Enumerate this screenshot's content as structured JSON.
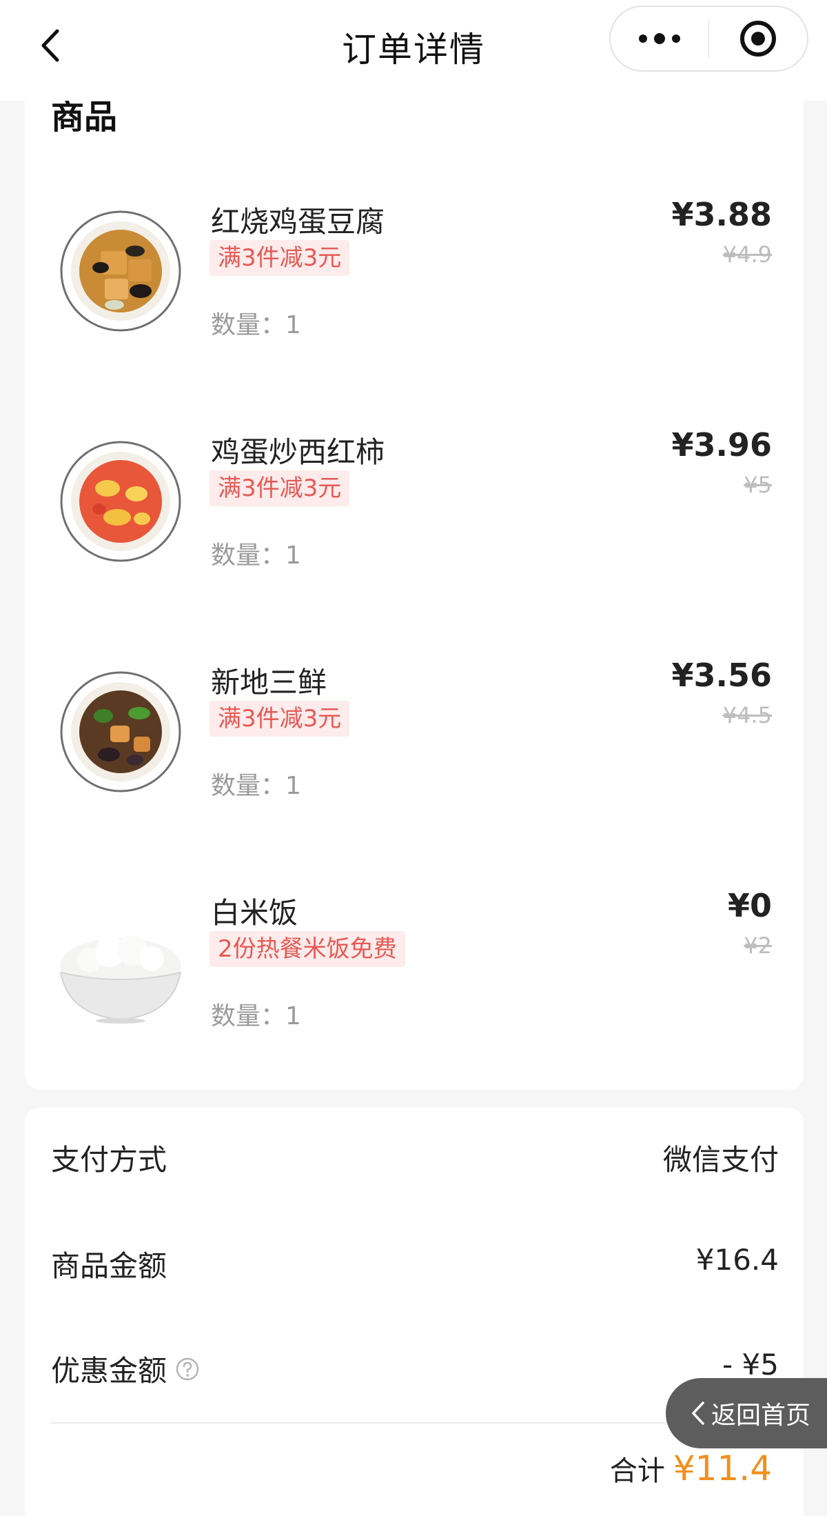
{
  "header": {
    "title": "订单详情",
    "back_icon": "chevron-left-icon",
    "menu_icon": "more-dots-icon",
    "close_icon": "target-circle-icon"
  },
  "goods": {
    "section_title": "商品",
    "items": [
      {
        "name": "红烧鸡蛋豆腐",
        "promo": "满3件减3元",
        "price": "¥3.88",
        "original_price": "¥4.9",
        "quantity": "数量：1",
        "image": "braised-egg-tofu-dish"
      },
      {
        "name": "鸡蛋炒西红柿",
        "promo": "满3件减3元",
        "price": "¥3.96",
        "original_price": "¥5",
        "quantity": "数量：1",
        "image": "tomato-egg-dish"
      },
      {
        "name": "新地三鲜",
        "promo": "满3件减3元",
        "price": "¥3.56",
        "original_price": "¥4.5",
        "quantity": "数量：1",
        "image": "di-san-xian-dish"
      },
      {
        "name": "白米饭",
        "promo": "2份热餐米饭免费",
        "price": "¥0",
        "original_price": "¥2",
        "quantity": "数量：1",
        "image": "white-rice-bowl"
      }
    ]
  },
  "payment": {
    "method_label": "支付方式",
    "method_value": "微信支付",
    "goods_amount_label": "商品金额",
    "goods_amount_value": "¥16.4",
    "discount_label": "优惠金额",
    "discount_value": "- ¥5",
    "total_label": "合计",
    "total_value": "¥11.4"
  },
  "float_button": {
    "label": "返回首页"
  },
  "colors": {
    "accent_orange": "#f0901c",
    "promo_red": "#e65a55",
    "promo_bg": "#fdeceb",
    "float_button_bg": "#5d5d5d"
  }
}
